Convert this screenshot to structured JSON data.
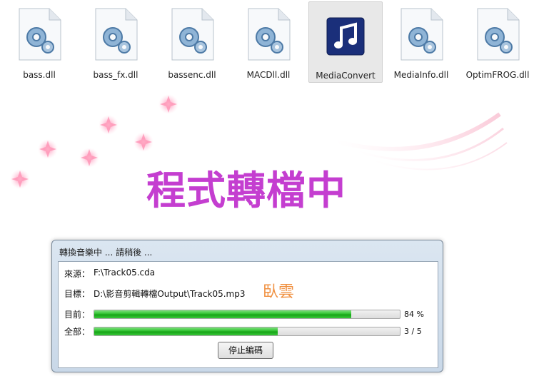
{
  "files": [
    {
      "name": "bass.dll",
      "icon": "dll-gear-icon",
      "selected": false
    },
    {
      "name": "bass_fx.dll",
      "icon": "dll-gear-icon",
      "selected": false
    },
    {
      "name": "bassenc.dll",
      "icon": "dll-gear-icon",
      "selected": false
    },
    {
      "name": "MACDll.dll",
      "icon": "dll-gear-icon",
      "selected": false
    },
    {
      "name": "MediaConvert",
      "icon": "music-note-app-icon",
      "selected": true
    },
    {
      "name": "MediaInfo.dll",
      "icon": "dll-gear-icon",
      "selected": false
    },
    {
      "name": "OptimFROG.dll",
      "icon": "dll-gear-icon",
      "selected": false
    }
  ],
  "banner": {
    "title": "程式轉檔中",
    "title_color": "#c43ed0"
  },
  "dialog": {
    "title": "轉換音樂中 ... 請稍後 ...",
    "source_label": "來源：",
    "source_value": "F:\\Track05.cda",
    "target_label": "目標：",
    "target_value": "D:\\影音剪輯轉檔Output\\Track05.mp3",
    "brand": "臥雲",
    "brand_color": "#f09040",
    "current_label": "目前：",
    "current_progress": 84,
    "current_text": "84 %",
    "total_label": "全部：",
    "total_done": 3,
    "total_count": 5,
    "total_text": "3 / 5",
    "stop_button": "停止編碼"
  }
}
